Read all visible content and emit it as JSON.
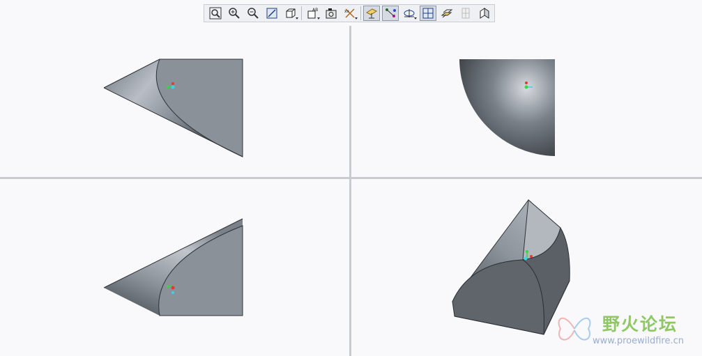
{
  "toolbar": {
    "buttons": [
      {
        "icon": "zoom-fit-icon",
        "active": false
      },
      {
        "icon": "zoom-in-icon",
        "active": false
      },
      {
        "icon": "zoom-out-icon",
        "active": false
      },
      {
        "icon": "repaint-icon",
        "active": false
      },
      {
        "icon": "display-style-icon",
        "active": false
      },
      {
        "icon": "saved-views-icon",
        "active": false
      },
      {
        "icon": "view-manager-icon",
        "active": false
      },
      {
        "icon": "datum-display-icon",
        "active": false
      },
      {
        "icon": "plane-display-icon",
        "active": true
      },
      {
        "icon": "axis-display-icon",
        "active": true
      },
      {
        "icon": "spin-center-icon",
        "active": false
      },
      {
        "icon": "multi-view-icon",
        "active": true
      },
      {
        "icon": "layer-icon",
        "active": false
      },
      {
        "icon": "section-icon",
        "active": false
      },
      {
        "icon": "appearance-icon",
        "active": false
      }
    ]
  },
  "colors": {
    "background": "#f9f9fb",
    "model_dark": "#4f555b",
    "model_mid": "#7d858e",
    "model_light": "#c4c8ce",
    "csys_x": "#e23a2e",
    "csys_y": "#3ad34a",
    "csys_z": "#35d6e8"
  },
  "watermark": {
    "title": "野火论坛",
    "url": "www.proewildfire.cn"
  }
}
